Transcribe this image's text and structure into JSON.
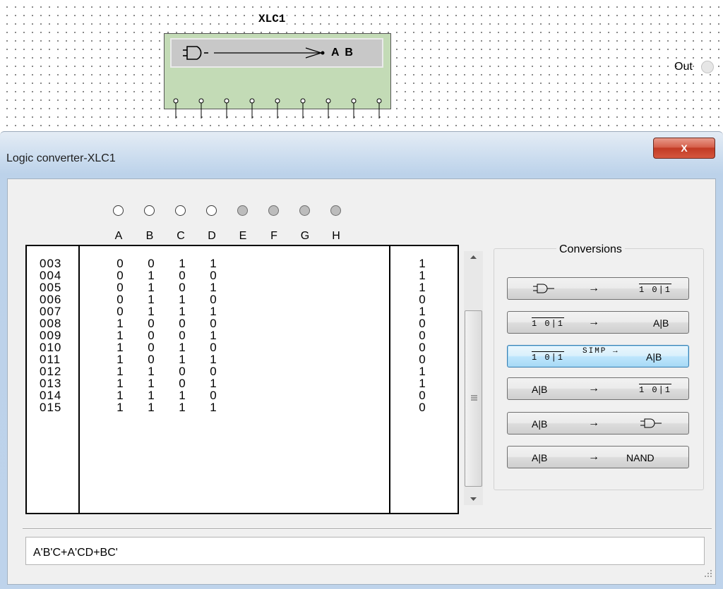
{
  "schematic": {
    "component_label": "XLC1",
    "display_text": "A B"
  },
  "window": {
    "title": "Logic converter-XLC1",
    "close_label": "X"
  },
  "output": {
    "label": "Out"
  },
  "inputs": [
    {
      "label": "A",
      "state": "active"
    },
    {
      "label": "B",
      "state": "active"
    },
    {
      "label": "C",
      "state": "active"
    },
    {
      "label": "D",
      "state": "active"
    },
    {
      "label": "E",
      "state": "inactive"
    },
    {
      "label": "F",
      "state": "inactive"
    },
    {
      "label": "G",
      "state": "inactive"
    },
    {
      "label": "H",
      "state": "inactive"
    }
  ],
  "truth_table": {
    "rows": [
      {
        "index": "003",
        "a": "0",
        "b": "0",
        "c": "1",
        "d": "1",
        "out": "1"
      },
      {
        "index": "004",
        "a": "0",
        "b": "1",
        "c": "0",
        "d": "0",
        "out": "1"
      },
      {
        "index": "005",
        "a": "0",
        "b": "1",
        "c": "0",
        "d": "1",
        "out": "1"
      },
      {
        "index": "006",
        "a": "0",
        "b": "1",
        "c": "1",
        "d": "0",
        "out": "0"
      },
      {
        "index": "007",
        "a": "0",
        "b": "1",
        "c": "1",
        "d": "1",
        "out": "1"
      },
      {
        "index": "008",
        "a": "1",
        "b": "0",
        "c": "0",
        "d": "0",
        "out": "0"
      },
      {
        "index": "009",
        "a": "1",
        "b": "0",
        "c": "0",
        "d": "1",
        "out": "0"
      },
      {
        "index": "010",
        "a": "1",
        "b": "0",
        "c": "1",
        "d": "0",
        "out": "0"
      },
      {
        "index": "011",
        "a": "1",
        "b": "0",
        "c": "1",
        "d": "1",
        "out": "0"
      },
      {
        "index": "012",
        "a": "1",
        "b": "1",
        "c": "0",
        "d": "0",
        "out": "1"
      },
      {
        "index": "013",
        "a": "1",
        "b": "1",
        "c": "0",
        "d": "1",
        "out": "1"
      },
      {
        "index": "014",
        "a": "1",
        "b": "1",
        "c": "1",
        "d": "0",
        "out": "0"
      },
      {
        "index": "015",
        "a": "1",
        "b": "1",
        "c": "1",
        "d": "1",
        "out": "0"
      }
    ]
  },
  "conversions": {
    "title": "Conversions",
    "buttons": [
      {
        "name": "circuit-to-truth-table",
        "left": "gate-icon",
        "middle": "→",
        "right": "1 0|1",
        "active": false
      },
      {
        "name": "truth-table-to-boolean",
        "left": "1 0|1",
        "middle": "→",
        "right": "A|B",
        "active": false
      },
      {
        "name": "truth-table-to-simplified-boolean",
        "left": "1 0|1",
        "middle": "SIMP →",
        "right": "A|B",
        "active": true
      },
      {
        "name": "boolean-to-truth-table",
        "left": "A|B",
        "middle": "→",
        "right": "1 0|1",
        "active": false
      },
      {
        "name": "boolean-to-circuit",
        "left": "A|B",
        "middle": "→",
        "right": "gate-icon",
        "active": false
      },
      {
        "name": "boolean-to-nand",
        "left": "A|B",
        "middle": "→",
        "right": "NAND",
        "active": false
      }
    ]
  },
  "expression": {
    "value": "A'B'C+A'CD+BC'"
  }
}
